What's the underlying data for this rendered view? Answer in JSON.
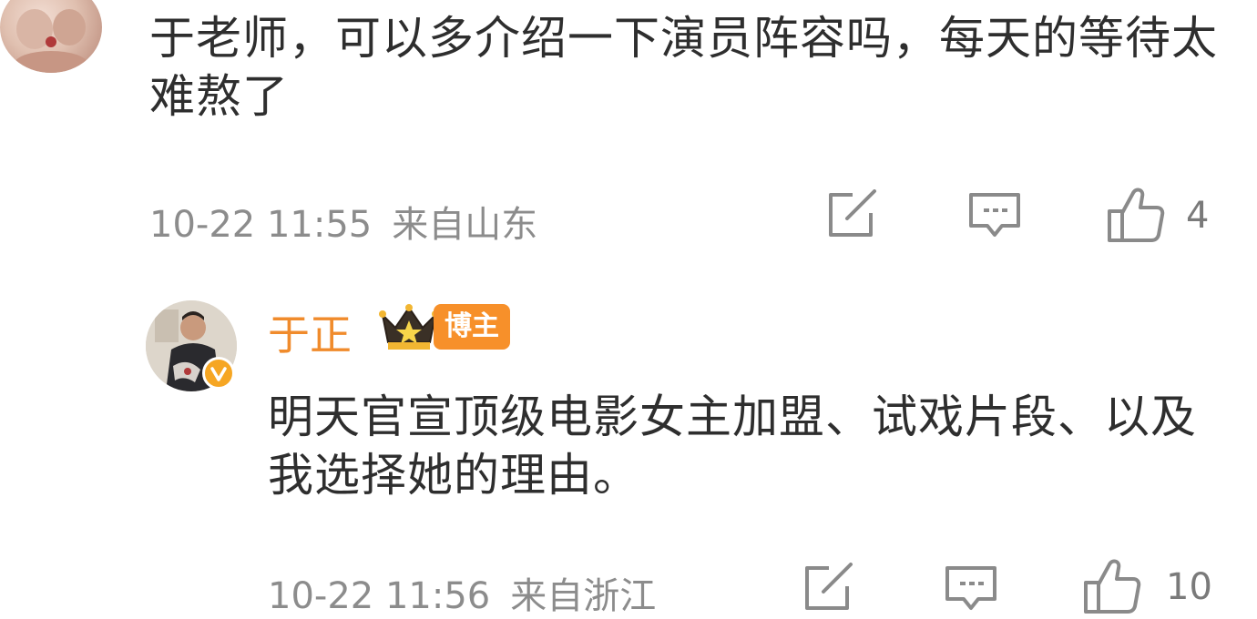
{
  "comments": [
    {
      "text": "于老师，可以多介绍一下演员阵容吗，每天的等待太难熬了",
      "time": "10-22 11:55",
      "location": "来自山东",
      "likes": "4"
    }
  ],
  "reply": {
    "username": "于正",
    "badge": "博主",
    "text": "明天官宣顶级电影女主加盟、试戏片段、以及我选择她的理由。",
    "time": "10-22 11:56",
    "location": "来自浙江",
    "likes": "10"
  },
  "icons": {
    "share": "share-icon",
    "comment": "comment-icon",
    "like": "thumbs-up-icon",
    "crown": "crown-icon",
    "verified": "verified-badge-icon"
  },
  "colors": {
    "username": "#f08b2c",
    "badge": "#f7902a",
    "meta": "#8c8c8c"
  }
}
